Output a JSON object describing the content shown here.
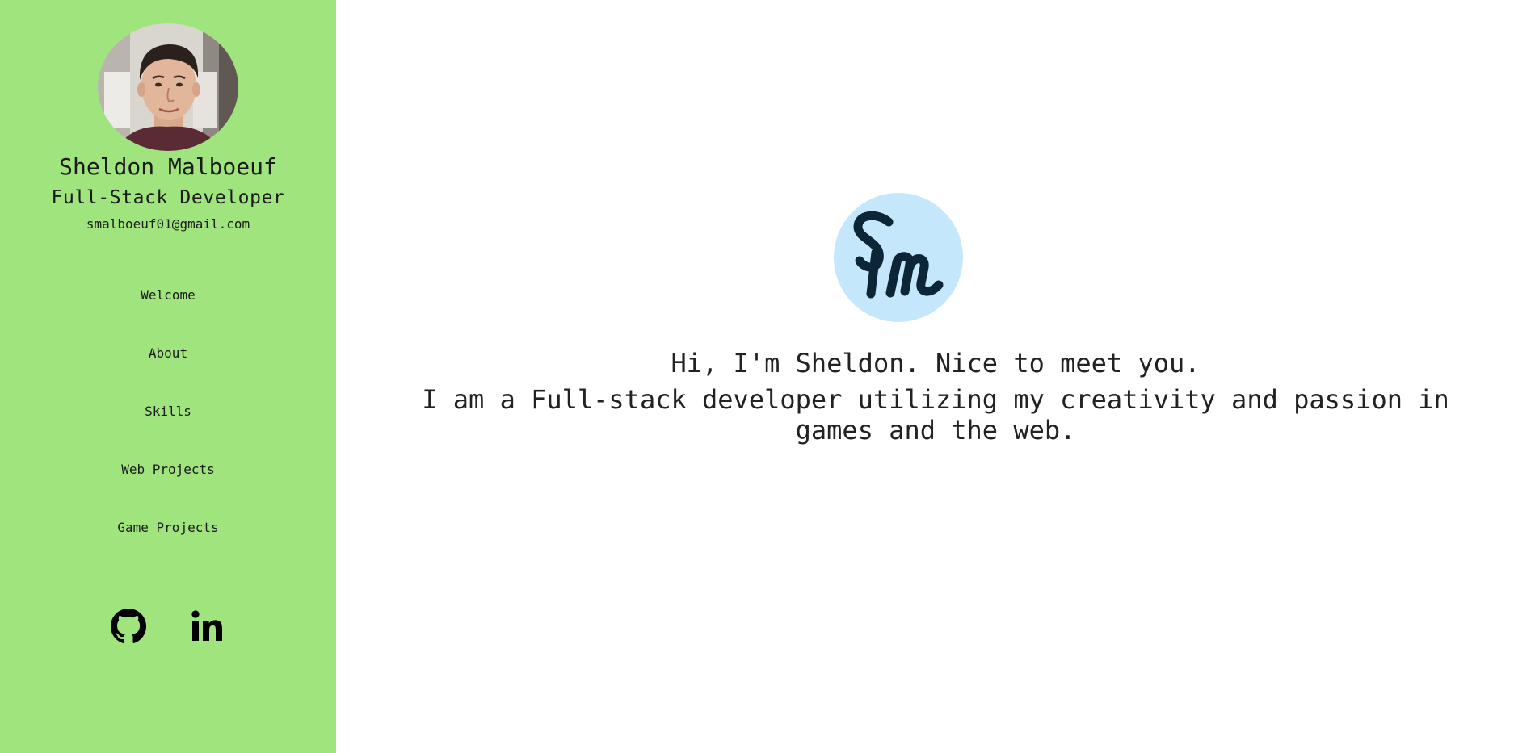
{
  "profile": {
    "name": "Sheldon Malboeuf",
    "role": "Full-Stack Developer",
    "email": "smalboeuf01@gmail.com"
  },
  "nav": {
    "items": [
      {
        "label": "Welcome"
      },
      {
        "label": "About"
      },
      {
        "label": "Skills"
      },
      {
        "label": "Web Projects"
      },
      {
        "label": "Game Projects"
      }
    ]
  },
  "social": {
    "icons": [
      "github-icon",
      "linkedin-icon"
    ]
  },
  "hero": {
    "greeting": "Hi, I'm Sheldon. Nice to meet you.",
    "intro": "I am a Full-stack developer utilizing my creativity and passion in games and the web."
  },
  "colors": {
    "sidebar": "#a0e47d",
    "logo_bg": "#c4e7fc",
    "logo_ink": "#0c2638"
  }
}
